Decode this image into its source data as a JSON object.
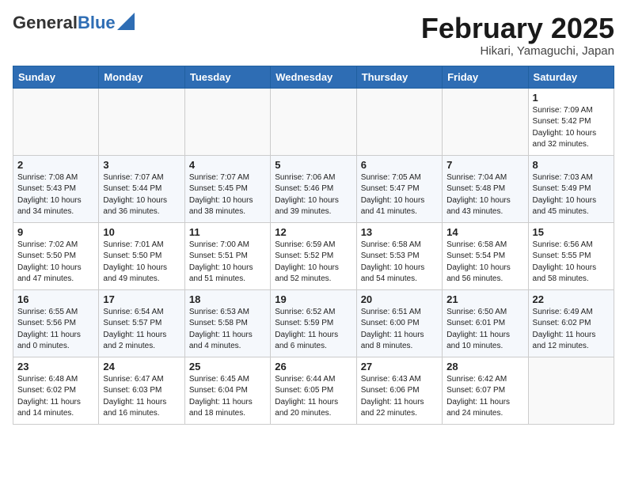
{
  "header": {
    "logo_general": "General",
    "logo_blue": "Blue",
    "month_title": "February 2025",
    "location": "Hikari, Yamaguchi, Japan"
  },
  "weekdays": [
    "Sunday",
    "Monday",
    "Tuesday",
    "Wednesday",
    "Thursday",
    "Friday",
    "Saturday"
  ],
  "weeks": [
    [
      {
        "day": "",
        "info": ""
      },
      {
        "day": "",
        "info": ""
      },
      {
        "day": "",
        "info": ""
      },
      {
        "day": "",
        "info": ""
      },
      {
        "day": "",
        "info": ""
      },
      {
        "day": "",
        "info": ""
      },
      {
        "day": "1",
        "info": "Sunrise: 7:09 AM\nSunset: 5:42 PM\nDaylight: 10 hours\nand 32 minutes."
      }
    ],
    [
      {
        "day": "2",
        "info": "Sunrise: 7:08 AM\nSunset: 5:43 PM\nDaylight: 10 hours\nand 34 minutes."
      },
      {
        "day": "3",
        "info": "Sunrise: 7:07 AM\nSunset: 5:44 PM\nDaylight: 10 hours\nand 36 minutes."
      },
      {
        "day": "4",
        "info": "Sunrise: 7:07 AM\nSunset: 5:45 PM\nDaylight: 10 hours\nand 38 minutes."
      },
      {
        "day": "5",
        "info": "Sunrise: 7:06 AM\nSunset: 5:46 PM\nDaylight: 10 hours\nand 39 minutes."
      },
      {
        "day": "6",
        "info": "Sunrise: 7:05 AM\nSunset: 5:47 PM\nDaylight: 10 hours\nand 41 minutes."
      },
      {
        "day": "7",
        "info": "Sunrise: 7:04 AM\nSunset: 5:48 PM\nDaylight: 10 hours\nand 43 minutes."
      },
      {
        "day": "8",
        "info": "Sunrise: 7:03 AM\nSunset: 5:49 PM\nDaylight: 10 hours\nand 45 minutes."
      }
    ],
    [
      {
        "day": "9",
        "info": "Sunrise: 7:02 AM\nSunset: 5:50 PM\nDaylight: 10 hours\nand 47 minutes."
      },
      {
        "day": "10",
        "info": "Sunrise: 7:01 AM\nSunset: 5:50 PM\nDaylight: 10 hours\nand 49 minutes."
      },
      {
        "day": "11",
        "info": "Sunrise: 7:00 AM\nSunset: 5:51 PM\nDaylight: 10 hours\nand 51 minutes."
      },
      {
        "day": "12",
        "info": "Sunrise: 6:59 AM\nSunset: 5:52 PM\nDaylight: 10 hours\nand 52 minutes."
      },
      {
        "day": "13",
        "info": "Sunrise: 6:58 AM\nSunset: 5:53 PM\nDaylight: 10 hours\nand 54 minutes."
      },
      {
        "day": "14",
        "info": "Sunrise: 6:58 AM\nSunset: 5:54 PM\nDaylight: 10 hours\nand 56 minutes."
      },
      {
        "day": "15",
        "info": "Sunrise: 6:56 AM\nSunset: 5:55 PM\nDaylight: 10 hours\nand 58 minutes."
      }
    ],
    [
      {
        "day": "16",
        "info": "Sunrise: 6:55 AM\nSunset: 5:56 PM\nDaylight: 11 hours\nand 0 minutes."
      },
      {
        "day": "17",
        "info": "Sunrise: 6:54 AM\nSunset: 5:57 PM\nDaylight: 11 hours\nand 2 minutes."
      },
      {
        "day": "18",
        "info": "Sunrise: 6:53 AM\nSunset: 5:58 PM\nDaylight: 11 hours\nand 4 minutes."
      },
      {
        "day": "19",
        "info": "Sunrise: 6:52 AM\nSunset: 5:59 PM\nDaylight: 11 hours\nand 6 minutes."
      },
      {
        "day": "20",
        "info": "Sunrise: 6:51 AM\nSunset: 6:00 PM\nDaylight: 11 hours\nand 8 minutes."
      },
      {
        "day": "21",
        "info": "Sunrise: 6:50 AM\nSunset: 6:01 PM\nDaylight: 11 hours\nand 10 minutes."
      },
      {
        "day": "22",
        "info": "Sunrise: 6:49 AM\nSunset: 6:02 PM\nDaylight: 11 hours\nand 12 minutes."
      }
    ],
    [
      {
        "day": "23",
        "info": "Sunrise: 6:48 AM\nSunset: 6:02 PM\nDaylight: 11 hours\nand 14 minutes."
      },
      {
        "day": "24",
        "info": "Sunrise: 6:47 AM\nSunset: 6:03 PM\nDaylight: 11 hours\nand 16 minutes."
      },
      {
        "day": "25",
        "info": "Sunrise: 6:45 AM\nSunset: 6:04 PM\nDaylight: 11 hours\nand 18 minutes."
      },
      {
        "day": "26",
        "info": "Sunrise: 6:44 AM\nSunset: 6:05 PM\nDaylight: 11 hours\nand 20 minutes."
      },
      {
        "day": "27",
        "info": "Sunrise: 6:43 AM\nSunset: 6:06 PM\nDaylight: 11 hours\nand 22 minutes."
      },
      {
        "day": "28",
        "info": "Sunrise: 6:42 AM\nSunset: 6:07 PM\nDaylight: 11 hours\nand 24 minutes."
      },
      {
        "day": "",
        "info": ""
      }
    ]
  ]
}
